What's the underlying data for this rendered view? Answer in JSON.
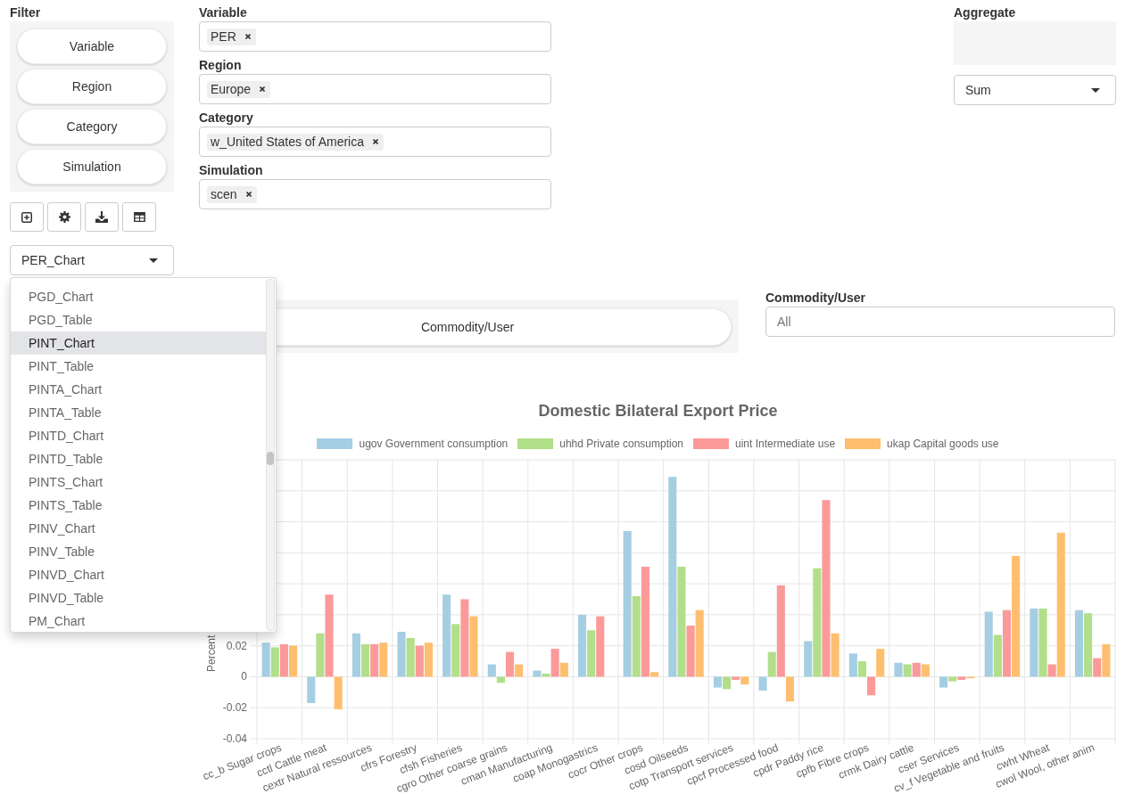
{
  "filter": {
    "label": "Filter",
    "buttons": [
      "Variable",
      "Region",
      "Category",
      "Simulation"
    ]
  },
  "view_select": {
    "value": "PER_Chart",
    "options": [
      {
        "label": "PGD_Chart",
        "selected": false
      },
      {
        "label": "PGD_Table",
        "selected": false
      },
      {
        "label": "PINT_Chart",
        "selected": true
      },
      {
        "label": "PINT_Table",
        "selected": false
      },
      {
        "label": "PINTA_Chart",
        "selected": false
      },
      {
        "label": "PINTA_Table",
        "selected": false
      },
      {
        "label": "PINTD_Chart",
        "selected": false
      },
      {
        "label": "PINTD_Table",
        "selected": false
      },
      {
        "label": "PINTS_Chart",
        "selected": false
      },
      {
        "label": "PINTS_Table",
        "selected": false
      },
      {
        "label": "PINV_Chart",
        "selected": false
      },
      {
        "label": "PINV_Table",
        "selected": false
      },
      {
        "label": "PINVD_Chart",
        "selected": false
      },
      {
        "label": "PINVD_Table",
        "selected": false
      },
      {
        "label": "PM_Chart",
        "selected": false
      }
    ]
  },
  "fields": [
    {
      "label": "Variable",
      "tags": [
        "PER"
      ]
    },
    {
      "label": "Region",
      "tags": [
        "Europe"
      ]
    },
    {
      "label": "Category",
      "tags": [
        "w_United States of America"
      ]
    },
    {
      "label": "Simulation",
      "tags": [
        "scen"
      ]
    }
  ],
  "aggregate": {
    "label": "Aggregate",
    "value": "Sum"
  },
  "pivot": {
    "buttons": [
      "Commodity/User"
    ]
  },
  "commodity_filter": {
    "label": "Commodity/User",
    "placeholder": "All"
  },
  "chart": {
    "chart_data": {
      "type": "bar",
      "title": "Domestic Bilateral Export Price",
      "ylabel": "Percent",
      "grid": true,
      "legend": true,
      "categories": [
        "cc_b Sugar crops",
        "cctl Cattle meat",
        "cextr Natural ressources",
        "cfrs Forestry",
        "cfsh Fisheries",
        "cgro Other coarse grains",
        "cman Manufacturing",
        "coap Monogastrics",
        "cocr Other crops",
        "cosd Oilseeds",
        "cotp Transport services",
        "cpcf Processed food",
        "cpdr Paddy rice",
        "cpfb Fibre crops",
        "crmk Dairy cattle",
        "cser Services",
        "cv_f Vegetable and fruits",
        "cwht Wheat",
        "cwol Wool, other anim"
      ],
      "series": [
        {
          "name": "ugov Government consumption",
          "color": "#a6cee3",
          "values": [
            0.022,
            -0.017,
            0.028,
            0.029,
            0.053,
            0.008,
            0.004,
            0.04,
            0.094,
            0.129,
            -0.007,
            -0.009,
            0.023,
            0.015,
            0.009,
            -0.007,
            0.042,
            0.044,
            0.043
          ]
        },
        {
          "name": "uhhd Private consumption",
          "color": "#b2df8a",
          "values": [
            0.019,
            0.028,
            0.021,
            0.025,
            0.034,
            -0.004,
            0.002,
            0.03,
            0.052,
            0.071,
            -0.008,
            0.016,
            0.07,
            0.01,
            0.008,
            -0.003,
            0.027,
            0.044,
            0.041
          ]
        },
        {
          "name": "uint Intermediate use",
          "color": "#fb9a99",
          "values": [
            0.021,
            0.053,
            0.021,
            0.02,
            0.05,
            0.016,
            0.018,
            0.039,
            0.071,
            0.033,
            -0.002,
            0.059,
            0.114,
            -0.012,
            0.009,
            -0.002,
            0.043,
            0.008,
            0.012
          ]
        },
        {
          "name": "ukap Capital goods use",
          "color": "#fdbf6f",
          "values": [
            0.02,
            -0.021,
            0.022,
            0.022,
            0.039,
            0.008,
            0.009,
            0,
            0.003,
            0.043,
            -0.005,
            -0.016,
            0.028,
            0.018,
            0.008,
            -0.001,
            0.078,
            0.093,
            0.021
          ]
        }
      ],
      "ylim": [
        -0.04,
        0.14
      ],
      "yticks": [
        -0.04,
        -0.02,
        0,
        0.02
      ]
    }
  }
}
